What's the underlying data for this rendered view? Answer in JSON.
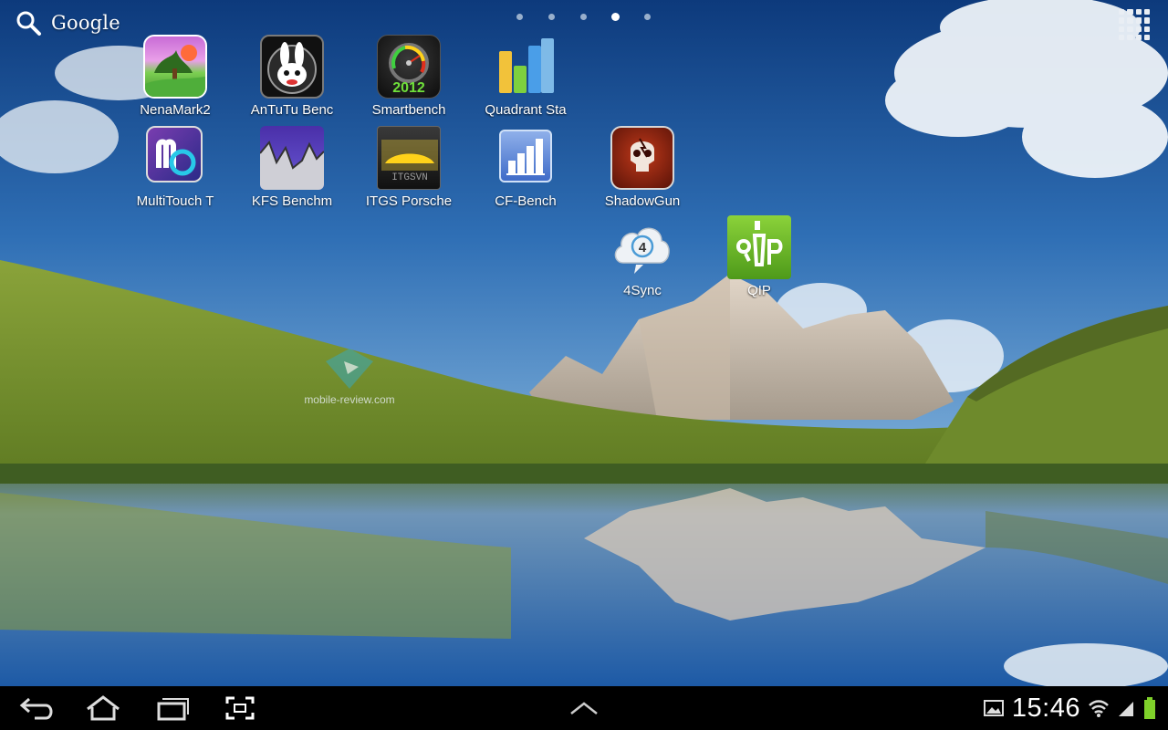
{
  "search": {
    "label": "Google"
  },
  "pager": {
    "pages": 5,
    "active_index": 3
  },
  "apps": [
    {
      "label": "NenaMark2"
    },
    {
      "label": "AnTuTu Benc"
    },
    {
      "label": "Smartbench"
    },
    {
      "label": "Quadrant Sta"
    },
    {
      "label": "MultiTouch T"
    },
    {
      "label": "KFS Benchm"
    },
    {
      "label": "ITGS Porsche"
    },
    {
      "label": "CF-Bench"
    },
    {
      "label": "ShadowGun"
    },
    {
      "label": "4Sync"
    },
    {
      "label": "QIP"
    }
  ],
  "icon_text": {
    "smartbench_year": "2012",
    "itgs_logo": "ITGSVN"
  },
  "watermark": {
    "text": "mobile-review.com"
  },
  "status_bar": {
    "time": "15:46",
    "accent": "#33b5e5",
    "battery_color": "#7fd12a"
  }
}
